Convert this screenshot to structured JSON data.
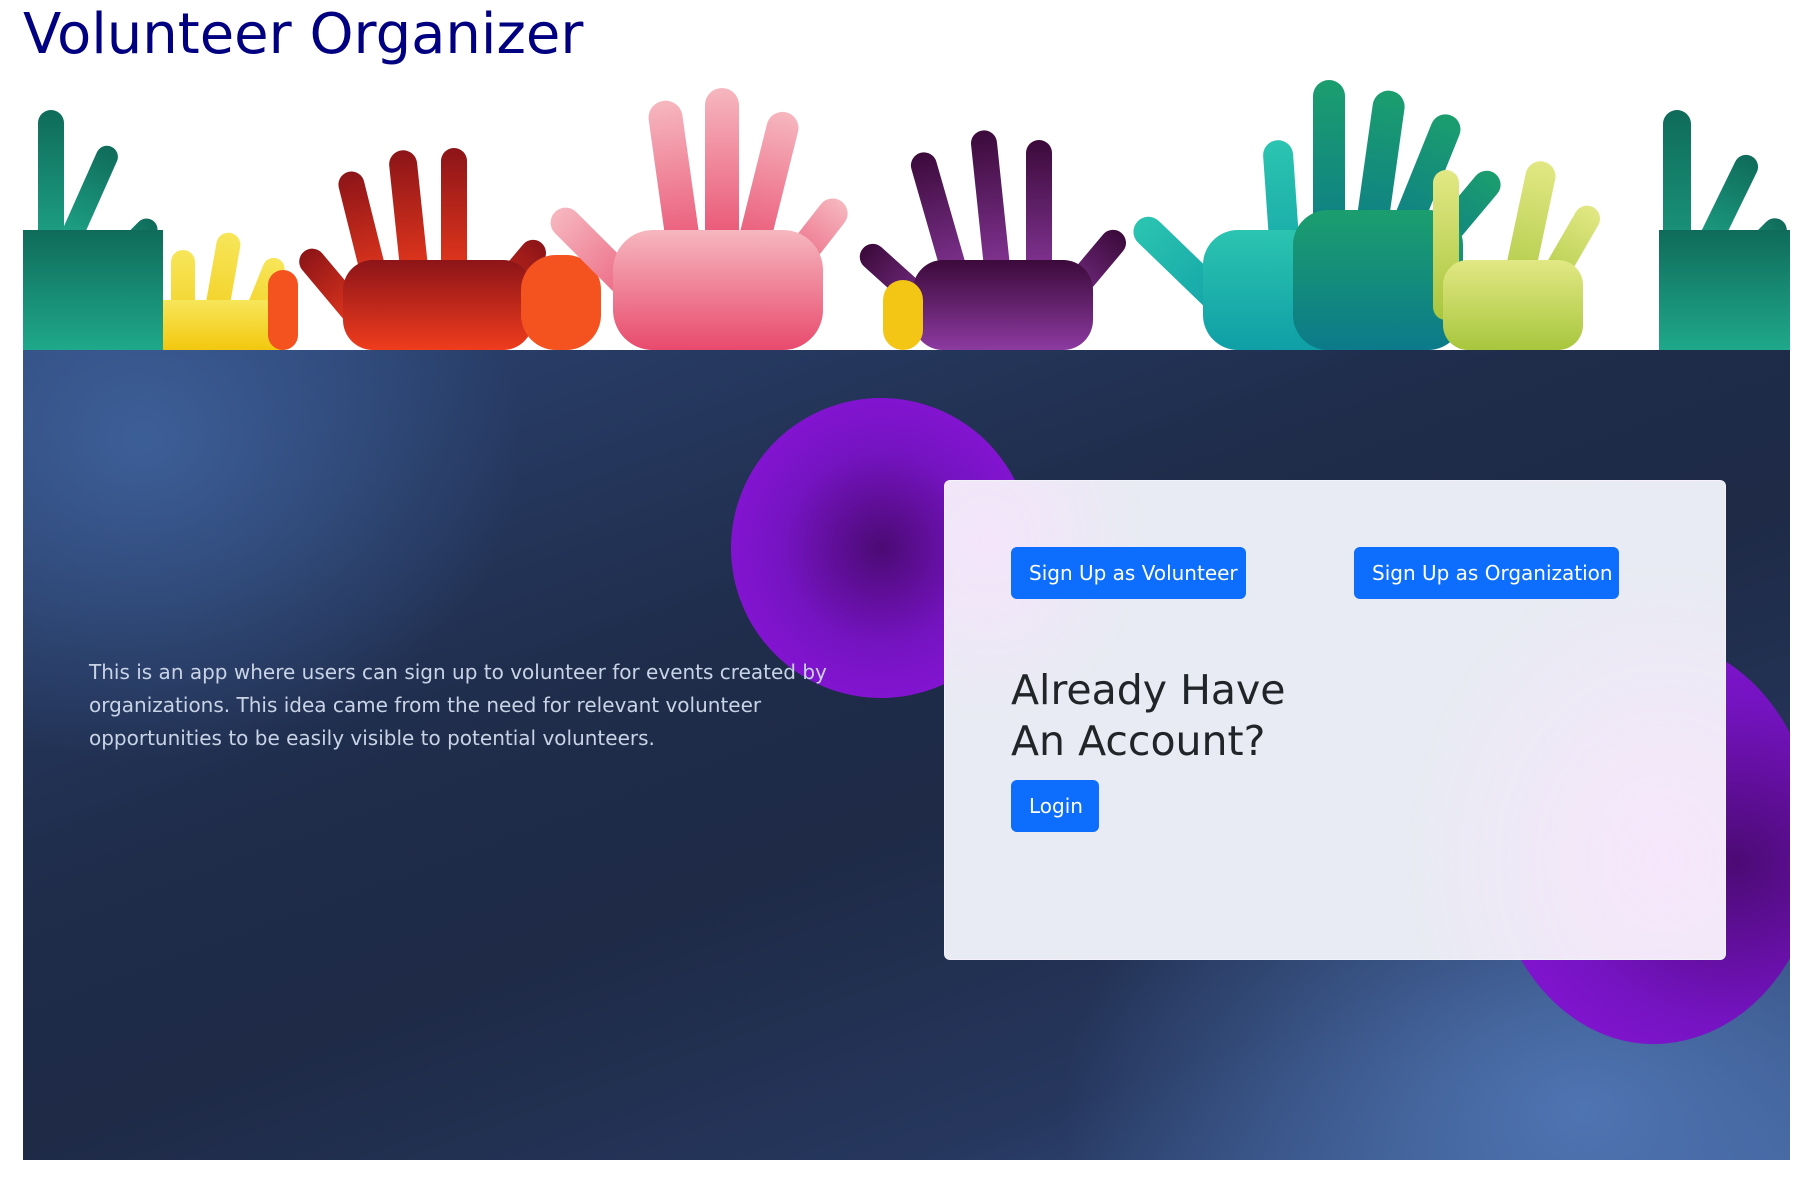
{
  "app": {
    "title": "Volunteer Organizer"
  },
  "banner": {
    "image_description": "colorful-raised-hands"
  },
  "hero": {
    "description": "This is an app where users can sign up to volunteer for events created by organizations. This idea came from the need for relevant volunteer opportunities to be easily visible to potential volunteers."
  },
  "auth_card": {
    "signup_volunteer_label": "Sign Up as Volunteer",
    "signup_organization_label": "Sign Up as Organization",
    "already_have_account": "Already Have An Account?",
    "login_label": "Login"
  },
  "colors": {
    "title": "#000080",
    "primary_button": "#0d6efd",
    "hero_background": "#1e2a46",
    "blob_purple": "#9316e4",
    "card_background": "#e8ebf3"
  }
}
